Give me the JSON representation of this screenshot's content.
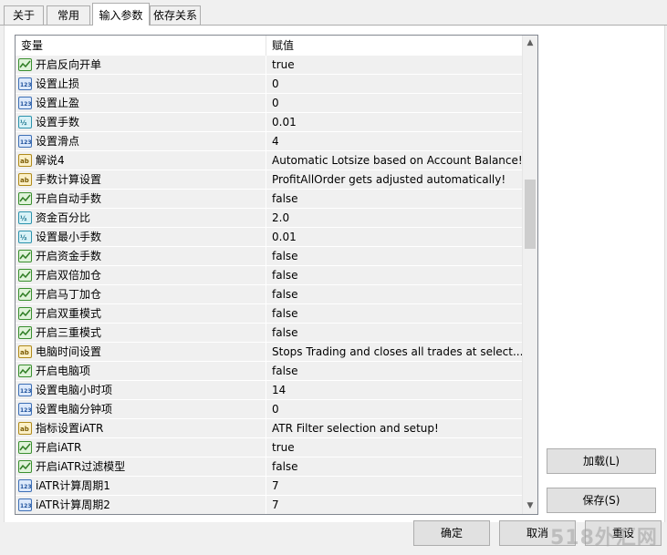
{
  "tabs": [
    {
      "label": "关于"
    },
    {
      "label": "常用"
    },
    {
      "label": "输入参数"
    },
    {
      "label": "依存关系"
    }
  ],
  "grid": {
    "headers": {
      "variable": "变量",
      "value": "赋值"
    },
    "rows": [
      {
        "icon": "bool-icon",
        "name": "开启反向开单",
        "value": "true"
      },
      {
        "icon": "int-icon",
        "name": "设置止损",
        "value": "0"
      },
      {
        "icon": "int-icon",
        "name": "设置止盈",
        "value": "0"
      },
      {
        "icon": "double-icon",
        "name": "设置手数",
        "value": "0.01"
      },
      {
        "icon": "int-icon",
        "name": "设置滑点",
        "value": "4"
      },
      {
        "icon": "string-icon",
        "name": "解说4",
        "value": "Automatic Lotsize based on Account Balance!"
      },
      {
        "icon": "string-icon",
        "name": "手数计算设置",
        "value": "ProfitAllOrder gets adjusted automatically!"
      },
      {
        "icon": "bool-icon",
        "name": "开启自动手数",
        "value": "false"
      },
      {
        "icon": "double-icon",
        "name": "资金百分比",
        "value": "2.0"
      },
      {
        "icon": "double-icon",
        "name": "设置最小手数",
        "value": "0.01"
      },
      {
        "icon": "bool-icon",
        "name": "开启资金手数",
        "value": "false"
      },
      {
        "icon": "bool-icon",
        "name": "开启双倍加仓",
        "value": "false"
      },
      {
        "icon": "bool-icon",
        "name": "开启马丁加仓",
        "value": "false"
      },
      {
        "icon": "bool-icon",
        "name": "开启双重模式",
        "value": "false"
      },
      {
        "icon": "bool-icon",
        "name": "开启三重模式",
        "value": "false"
      },
      {
        "icon": "string-icon",
        "name": "电脑时间设置",
        "value": "Stops Trading and closes all trades at select..."
      },
      {
        "icon": "bool-icon",
        "name": "开启电脑项",
        "value": "false"
      },
      {
        "icon": "int-icon",
        "name": "设置电脑小时项",
        "value": "14"
      },
      {
        "icon": "int-icon",
        "name": "设置电脑分钟项",
        "value": "0"
      },
      {
        "icon": "string-icon",
        "name": "指标设置iATR",
        "value": "ATR Filter selection and setup!"
      },
      {
        "icon": "bool-icon",
        "name": "开启iATR",
        "value": "true"
      },
      {
        "icon": "bool-icon",
        "name": "开启iATR过滤模型",
        "value": "false"
      },
      {
        "icon": "int-icon",
        "name": "iATR计算周期1",
        "value": "7"
      },
      {
        "icon": "int-icon",
        "name": "iATR计算周期2",
        "value": "7"
      }
    ],
    "scroll_position": 0.34
  },
  "buttons": {
    "load": "加载(L)",
    "save": "保存(S)",
    "ok": "确定",
    "cancel": "取消",
    "reset": "重设"
  },
  "watermark": "518外汇网"
}
